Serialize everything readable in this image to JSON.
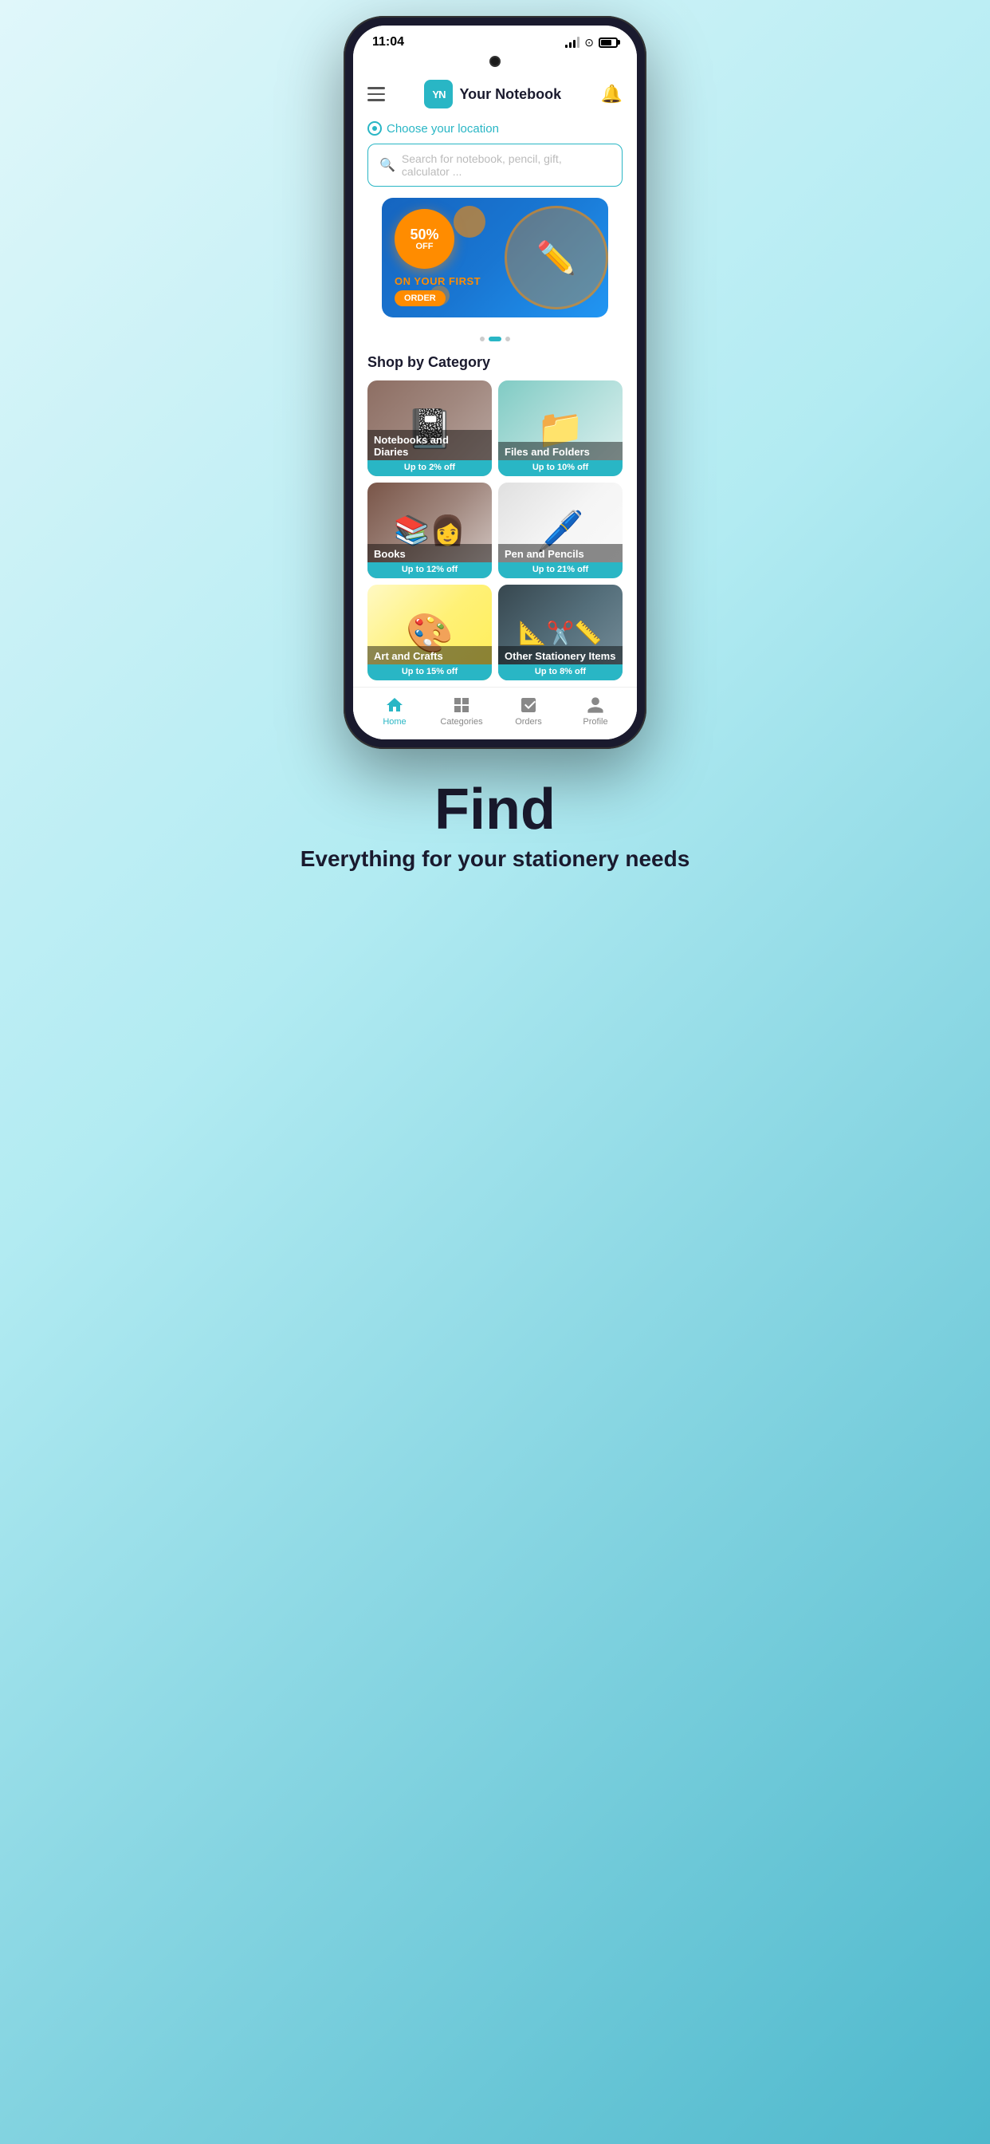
{
  "status": {
    "time": "11:04"
  },
  "header": {
    "logo_letters": "YN",
    "app_name": "Your Notebook"
  },
  "location": {
    "text": "Choose your location"
  },
  "search": {
    "placeholder": "Search for notebook, pencil, gift, calculator ..."
  },
  "banner": {
    "discount_percent": "50%",
    "discount_off": "OFF",
    "line1": "ON YOUR FIRST",
    "order_badge": "ORDER",
    "stationery_emoji": "✏️📚"
  },
  "section_title": "Shop by Category",
  "categories": [
    {
      "name": "Notebooks and Diaries",
      "discount": "Up to 2% off",
      "bg_class": "card-bg-notebooks",
      "emoji": "📓"
    },
    {
      "name": "Files and Folders",
      "discount": "Up to 10% off",
      "bg_class": "card-bg-files",
      "emoji": "📁"
    },
    {
      "name": "Books",
      "discount": "Up to 12% off",
      "bg_class": "card-bg-books",
      "emoji": "📚"
    },
    {
      "name": "Pen and Pencils",
      "discount": "Up to 21% off",
      "bg_class": "card-bg-pens",
      "emoji": "🖊️"
    },
    {
      "name": "Art and Crafts",
      "discount": "Up to 15% off",
      "bg_class": "card-bg-art",
      "emoji": "🎨"
    },
    {
      "name": "Other Stationery Items",
      "discount": "Up to 8% off",
      "bg_class": "card-bg-other",
      "emoji": "📐"
    }
  ],
  "nav": [
    {
      "label": "Home",
      "active": true
    },
    {
      "label": "Categories",
      "active": false
    },
    {
      "label": "Orders",
      "active": false
    },
    {
      "label": "Profile",
      "active": false
    }
  ],
  "tagline": {
    "main": "Find",
    "sub": "Everything for your stationery needs"
  }
}
